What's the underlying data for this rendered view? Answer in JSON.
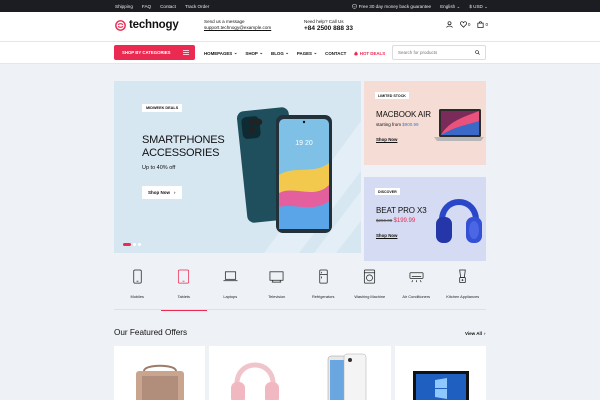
{
  "topbar": {
    "links": [
      "Shipping",
      "FAQ",
      "Contact",
      "Track Order"
    ],
    "guarantee": "Free 30 day money back guarantee",
    "language": "English",
    "currency": "$ USD"
  },
  "header": {
    "logo": "technogy",
    "email_label": "Send us a message",
    "email": "support.technogy@example.com",
    "phone_label": "Need help? Call Us",
    "phone": "+84 2500 888 33",
    "wishlist_count": "0",
    "cart_count": "0"
  },
  "nav": {
    "categories_button": "SHOP BY CATEGORIES",
    "menu": [
      {
        "label": "HOMEPAGES",
        "chevron": true
      },
      {
        "label": "SHOP",
        "chevron": true
      },
      {
        "label": "BLOG",
        "chevron": true
      },
      {
        "label": "PAGES",
        "chevron": true
      },
      {
        "label": "CONTACT",
        "chevron": false
      }
    ],
    "hot_deals": "HOT DEALS",
    "search_placeholder": "Search for products"
  },
  "hero": {
    "tag": "MIDWEEK DEALS",
    "title_line1": "SMARTPHONES",
    "title_line2": "ACCESSORIES",
    "subtitle": "Up to 40% off",
    "button": "Shop Now",
    "slides": 3,
    "active_slide": 1
  },
  "side_cards": {
    "macbook": {
      "tag": "LIMITED STOCK",
      "title": "MACBOOK AIR",
      "price_prefix": "starting from",
      "price": "$900.99",
      "link": "Shop Now"
    },
    "beats": {
      "tag": "DISCOVER",
      "title": "BEAT PRO X3",
      "old_price": "$250.00",
      "new_price": "$199.99",
      "link": "Shop Now"
    }
  },
  "categories": [
    {
      "label": "Mobiles",
      "icon": "mobile-icon"
    },
    {
      "label": "Tablets",
      "icon": "tablet-icon",
      "active": true
    },
    {
      "label": "Laptops",
      "icon": "laptop-icon"
    },
    {
      "label": "Television",
      "icon": "television-icon"
    },
    {
      "label": "Refrigerators",
      "icon": "refrigerator-icon"
    },
    {
      "label": "Washing Machine",
      "icon": "washing-machine-icon"
    },
    {
      "label": "Air Conditioners",
      "icon": "air-conditioner-icon"
    },
    {
      "label": "Kitchen Appliances",
      "icon": "blender-icon"
    }
  ],
  "featured": {
    "title": "Our Featured Offers",
    "view_all": "View All"
  },
  "colors": {
    "accent": "#ea2a50",
    "hero_bg": "#d6e7f2",
    "macbook_bg": "#f5dcd4",
    "beats_bg": "#d5dbf3"
  }
}
